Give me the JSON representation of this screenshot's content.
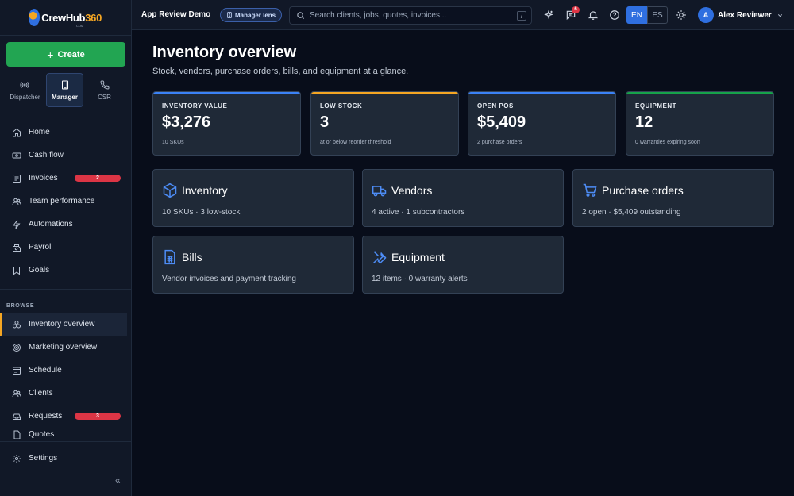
{
  "brand": {
    "name_main": "CrewHub",
    "name_num": "360",
    "sub": "COM"
  },
  "sidebar": {
    "create_label": "Create",
    "roles": [
      {
        "label": "Dispatcher",
        "icon": "broadcast-icon",
        "active": false
      },
      {
        "label": "Manager",
        "icon": "building-icon",
        "active": true
      },
      {
        "label": "CSR",
        "icon": "phone-icon",
        "active": false
      }
    ],
    "items": [
      {
        "label": "Home",
        "icon": "home-icon"
      },
      {
        "label": "Cash flow",
        "icon": "cash-icon"
      },
      {
        "label": "Invoices",
        "icon": "invoice-icon",
        "badge": "2"
      },
      {
        "label": "Team performance",
        "icon": "team-icon"
      },
      {
        "label": "Automations",
        "icon": "bolt-icon"
      },
      {
        "label": "Payroll",
        "icon": "payroll-icon"
      },
      {
        "label": "Goals",
        "icon": "goal-icon"
      }
    ],
    "browse_label": "BROWSE",
    "browse_items": [
      {
        "label": "Inventory overview",
        "icon": "boxes-icon",
        "active": true
      },
      {
        "label": "Marketing overview",
        "icon": "target-icon"
      },
      {
        "label": "Schedule",
        "icon": "calendar-icon"
      },
      {
        "label": "Clients",
        "icon": "clients-icon"
      },
      {
        "label": "Requests",
        "icon": "inbox-icon",
        "badge": "3"
      },
      {
        "label": "Quotes",
        "icon": "quote-icon"
      }
    ],
    "settings_label": "Settings",
    "collapse_icon": "«"
  },
  "topbar": {
    "app_title": "App Review Demo",
    "lens_label": "Manager lens",
    "search_placeholder": "Search clients, jobs, quotes, invoices...",
    "search_shortcut": "/",
    "messages_badge": "6",
    "lang_en": "EN",
    "lang_es": "ES",
    "user_initial": "A",
    "user_name": "Alex Reviewer"
  },
  "page": {
    "title": "Inventory overview",
    "subtitle": "Stock, vendors, purchase orders, bills, and equipment at a glance."
  },
  "stats": [
    {
      "label": "INVENTORY VALUE",
      "value": "$3,276",
      "note": "10 SKUs",
      "color": "#3b82f6"
    },
    {
      "label": "LOW STOCK",
      "value": "3",
      "note": "at or below reorder threshold",
      "color": "#f5a623"
    },
    {
      "label": "OPEN POS",
      "value": "$5,409",
      "note": "2 purchase orders",
      "color": "#3b82f6"
    },
    {
      "label": "EQUIPMENT",
      "value": "12",
      "note": "0 warranties expiring soon",
      "color": "#16a34a"
    }
  ],
  "cards": [
    {
      "title": "Inventory",
      "desc": "10 SKUs · 3 low-stock",
      "icon": "box-icon"
    },
    {
      "title": "Vendors",
      "desc": "4 active · 1 subcontractors",
      "icon": "truck-icon"
    },
    {
      "title": "Purchase orders",
      "desc": "2 open · $5,409 outstanding",
      "icon": "cart-icon"
    },
    {
      "title": "Bills",
      "desc": "Vendor invoices and payment tracking",
      "icon": "bill-icon"
    },
    {
      "title": "Equipment",
      "desc": "12 items · 0 warranty alerts",
      "icon": "tools-icon"
    }
  ]
}
